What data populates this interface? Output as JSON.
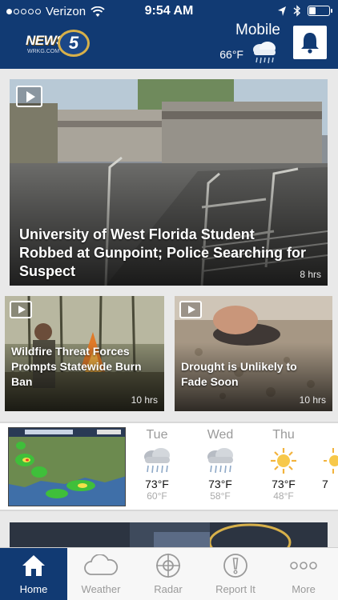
{
  "status_bar": {
    "carrier": "Verizon",
    "time": "9:54 AM",
    "signal_bars": 1,
    "signal_total": 5,
    "battery_level": 0.3
  },
  "header": {
    "logo": {
      "news": "NEWS",
      "number": "5",
      "call_sign": "WRKG.COM"
    },
    "city": "Mobile",
    "temperature": "66°F",
    "condition_icon": "rain-cloud-icon",
    "alerts_icon": "bell-icon"
  },
  "stories": {
    "featured": {
      "headline": "University of West Florida Student Robbed at Gunpoint; Police Searching for Suspect",
      "age": "8 hrs",
      "has_video": true
    },
    "secondary": [
      {
        "headline": "Wildfire Threat Forces Prompts Statewide Burn Ban",
        "age": "10 hrs",
        "has_video": true
      },
      {
        "headline": "Drought is Unlikely to Fade Soon",
        "age": "10 hrs",
        "has_video": true
      }
    ]
  },
  "forecast": {
    "radar_icon": "radar-map",
    "days": [
      {
        "name": "Tue",
        "icon": "rain-cloud-icon",
        "high": "73°F",
        "low": "60°F"
      },
      {
        "name": "Wed",
        "icon": "rain-cloud-icon",
        "high": "73°F",
        "low": "58°F"
      },
      {
        "name": "Thu",
        "icon": "sun-icon",
        "high": "73°F",
        "low": "48°F"
      },
      {
        "name": "",
        "icon": "sun-icon",
        "high": "7",
        "low": ""
      }
    ]
  },
  "tabbar": {
    "tabs": [
      {
        "label": "Home",
        "icon": "home-icon",
        "active": true
      },
      {
        "label": "Weather",
        "icon": "cloud-icon",
        "active": false
      },
      {
        "label": "Radar",
        "icon": "crosshair-icon",
        "active": false
      },
      {
        "label": "Report It",
        "icon": "exclamation-icon",
        "active": false
      },
      {
        "label": "More",
        "icon": "more-dots-icon",
        "active": false
      }
    ]
  },
  "colors": {
    "brand_blue": "#113a73",
    "logo_gold": "#d7b04a",
    "tab_inactive": "#9a9a9a"
  }
}
